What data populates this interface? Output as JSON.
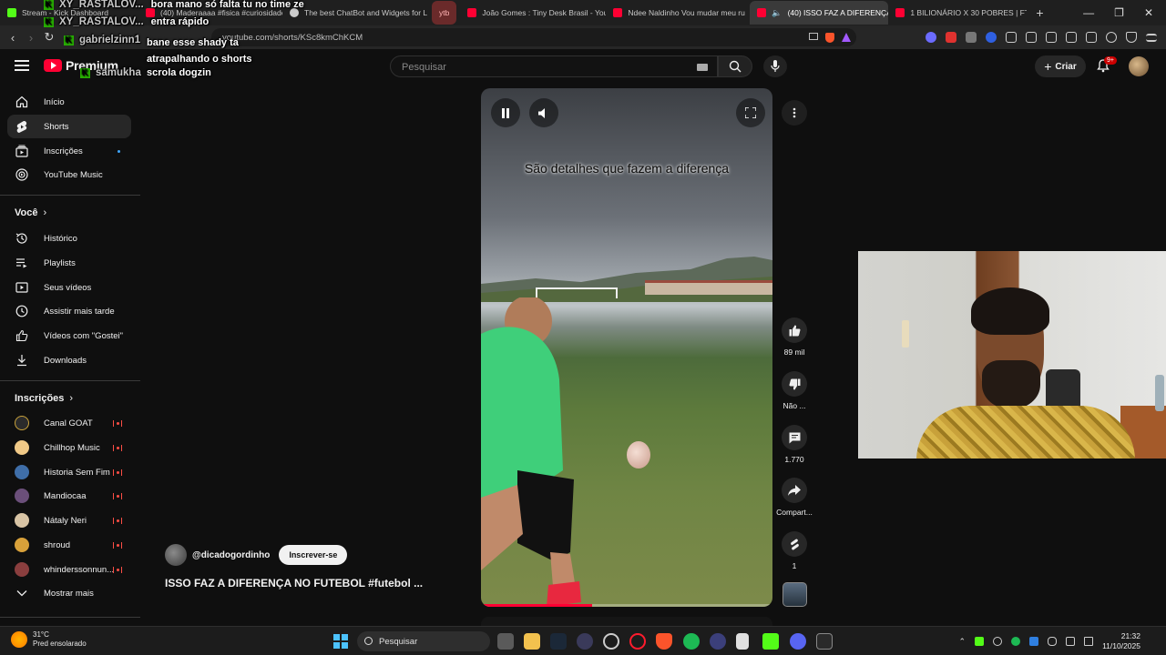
{
  "browser": {
    "tabs": [
      {
        "label": "Stream - Kick Dashboard",
        "color": "#53fc18"
      },
      {
        "label": "(40) Maderaaaa #fisica #curiosidades",
        "color": "#ff0033"
      },
      {
        "label": "The best ChatBot and Widgets for L",
        "color": "#cccccc"
      },
      {
        "label": "ytb",
        "color": "#ff6b6b"
      },
      {
        "label": "João Gomes : Tiny Desk Brasil - You",
        "color": "#ff0033"
      },
      {
        "label": "Ndee Naldinho Vou mudar meu ru",
        "color": "#ff0033"
      },
      {
        "label": "(40) ISSO FAZ A DIFERENÇA",
        "color": "#ff0033"
      },
      {
        "label": "1 BILIONÁRIO X 30 POBRES | FT. PA",
        "color": "#ff0033"
      }
    ],
    "url": "youtube.com/shorts/KSc8kmChKCM",
    "new_tab": "+",
    "window_controls": [
      "—",
      "❐",
      "✕"
    ]
  },
  "chat": [
    {
      "user": "XY_RASTALOV...",
      "msg": "bora mano só falta tu no time ze"
    },
    {
      "user": "XY_RASTALOV...",
      "msg": "entra rápido"
    },
    {
      "user": "gabrielzinn1",
      "msg": "bane esse shady ta atrapalhando o shorts"
    },
    {
      "user": "samukha",
      "msg": "scrola dogzin"
    }
  ],
  "header": {
    "logo_text": "Premium",
    "country": "BR",
    "search_placeholder": "Pesquisar",
    "create_label": "Criar",
    "notif_badge": "9+"
  },
  "sidebar": {
    "main": [
      {
        "label": "Início",
        "icon": "home-icon"
      },
      {
        "label": "Shorts",
        "icon": "shorts-icon"
      },
      {
        "label": "Inscrições",
        "icon": "subscriptions-icon"
      },
      {
        "label": "YouTube Music",
        "icon": "music-icon"
      }
    ],
    "you_heading": "Você",
    "you": [
      {
        "label": "Histórico",
        "icon": "history-icon"
      },
      {
        "label": "Playlists",
        "icon": "playlists-icon"
      },
      {
        "label": "Seus vídeos",
        "icon": "your-videos-icon"
      },
      {
        "label": "Assistir mais tarde",
        "icon": "watch-later-icon"
      },
      {
        "label": "Vídeos com \"Gostei\"",
        "icon": "liked-icon"
      },
      {
        "label": "Downloads",
        "icon": "download-icon"
      }
    ],
    "subs_heading": "Inscrições",
    "subs": [
      {
        "label": "Canal GOAT",
        "color": "#2b2b2b"
      },
      {
        "label": "Chillhop Music",
        "color": "#f0c987"
      },
      {
        "label": "Historia Sem Fim",
        "color": "#3f6ea8"
      },
      {
        "label": "Mandiocaa",
        "color": "#6b4f7a"
      },
      {
        "label": "Nátaly Neri",
        "color": "#d8c4a5"
      },
      {
        "label": "shroud",
        "color": "#d8a13a"
      },
      {
        "label": "whinderssonnun...",
        "color": "#8a3e3e"
      }
    ],
    "show_more": "Mostrar mais"
  },
  "video": {
    "caption": "São detalhes que fazem a diferença",
    "progress": 0.38,
    "channel": "@dicadogordinho",
    "subscribe": "Inscrever-se",
    "title": "ISSO FAZ A DIFERENÇA NO FUTEBOL #futebol ..."
  },
  "actions": [
    {
      "label": "89 mil",
      "icon": "like-icon"
    },
    {
      "label": "Não ...",
      "icon": "dislike-icon"
    },
    {
      "label": "1.770",
      "icon": "comment-icon"
    },
    {
      "label": "Compart...",
      "icon": "share-icon"
    },
    {
      "label": "1",
      "icon": "remix-icon"
    }
  ],
  "taskbar": {
    "temp": "31°C",
    "weather": "Pred ensolarado",
    "search": "Pesquisar",
    "time": "21:32",
    "date": "11/10/2025"
  }
}
